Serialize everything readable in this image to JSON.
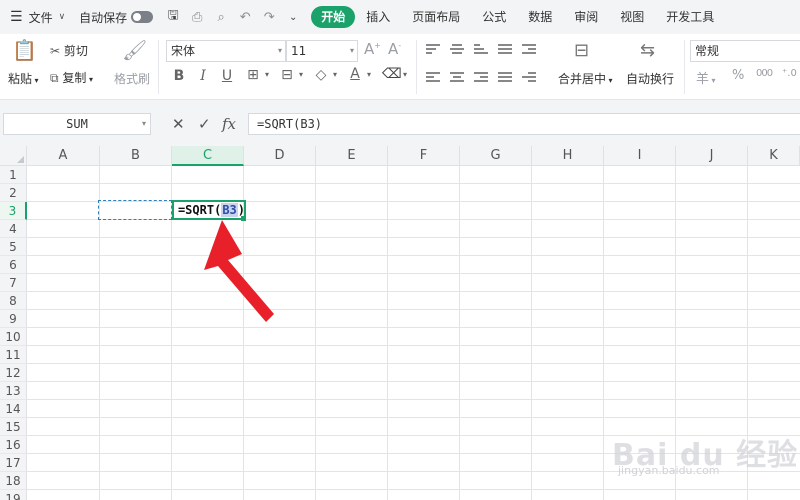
{
  "menubar": {
    "file_label": "文件",
    "autosave_label": "自动保存",
    "tabs": [
      {
        "label": "开始",
        "active": true
      },
      {
        "label": "插入",
        "active": false
      },
      {
        "label": "页面布局",
        "active": false
      },
      {
        "label": "公式",
        "active": false
      },
      {
        "label": "数据",
        "active": false
      },
      {
        "label": "审阅",
        "active": false
      },
      {
        "label": "视图",
        "active": false
      },
      {
        "label": "开发工具",
        "active": false
      }
    ]
  },
  "ribbon": {
    "paste_label": "粘贴",
    "cut_label": "剪切",
    "copy_label": "复制",
    "format_painter_label": "格式刷",
    "font_name": "宋体",
    "font_size": "11",
    "merge_center_label": "合并居中",
    "wrap_text_label": "自动换行",
    "number_format": "常规",
    "currency_symbol": "羊",
    "percent_symbol": "%"
  },
  "formulabar": {
    "name_box": "SUM",
    "fx_label": "fx",
    "formula": "=SQRT(B3)"
  },
  "sheet": {
    "columns": [
      "A",
      "B",
      "C",
      "D",
      "E",
      "F",
      "G",
      "H",
      "I",
      "J",
      "K"
    ],
    "active_column": "C",
    "rows": [
      "1",
      "2",
      "3",
      "4",
      "5",
      "6",
      "7",
      "8",
      "9",
      "10",
      "11",
      "12",
      "13",
      "14",
      "15",
      "16",
      "17",
      "18",
      "19"
    ],
    "active_row": "3",
    "edit_cell": {
      "prefix": "=SQRT(",
      "reference": "B3",
      "suffix": ")"
    }
  },
  "colors": {
    "accent": "#1aa26a",
    "reference_highlight": "#c9d3ee",
    "arrow": "#e8202a"
  },
  "watermark": {
    "brand": "Bai du 经验",
    "url": "jingyan.baidu.com"
  }
}
